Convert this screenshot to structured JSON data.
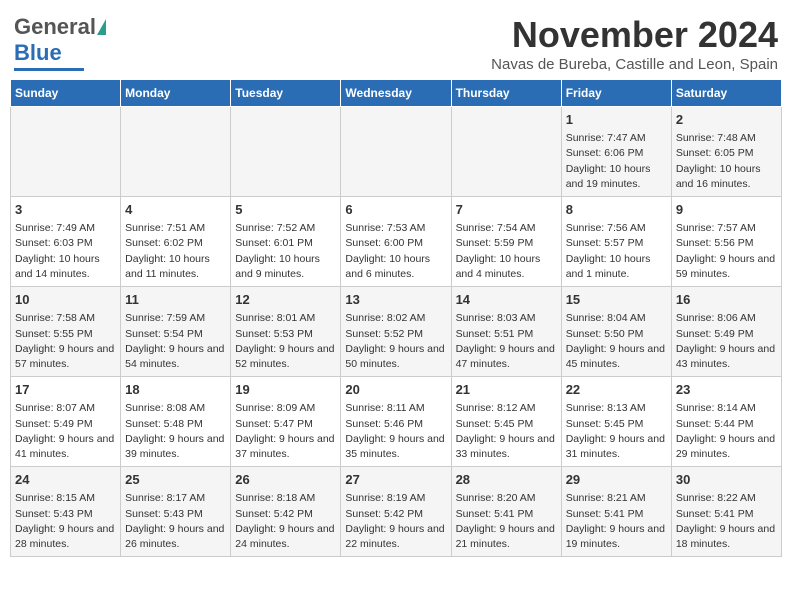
{
  "header": {
    "logo_general": "General",
    "logo_blue": "Blue",
    "month_title": "November 2024",
    "location": "Navas de Bureba, Castille and Leon, Spain"
  },
  "days_of_week": [
    "Sunday",
    "Monday",
    "Tuesday",
    "Wednesday",
    "Thursday",
    "Friday",
    "Saturday"
  ],
  "weeks": [
    [
      {
        "day": "",
        "info": ""
      },
      {
        "day": "",
        "info": ""
      },
      {
        "day": "",
        "info": ""
      },
      {
        "day": "",
        "info": ""
      },
      {
        "day": "",
        "info": ""
      },
      {
        "day": "1",
        "info": "Sunrise: 7:47 AM\nSunset: 6:06 PM\nDaylight: 10 hours and 19 minutes."
      },
      {
        "day": "2",
        "info": "Sunrise: 7:48 AM\nSunset: 6:05 PM\nDaylight: 10 hours and 16 minutes."
      }
    ],
    [
      {
        "day": "3",
        "info": "Sunrise: 7:49 AM\nSunset: 6:03 PM\nDaylight: 10 hours and 14 minutes."
      },
      {
        "day": "4",
        "info": "Sunrise: 7:51 AM\nSunset: 6:02 PM\nDaylight: 10 hours and 11 minutes."
      },
      {
        "day": "5",
        "info": "Sunrise: 7:52 AM\nSunset: 6:01 PM\nDaylight: 10 hours and 9 minutes."
      },
      {
        "day": "6",
        "info": "Sunrise: 7:53 AM\nSunset: 6:00 PM\nDaylight: 10 hours and 6 minutes."
      },
      {
        "day": "7",
        "info": "Sunrise: 7:54 AM\nSunset: 5:59 PM\nDaylight: 10 hours and 4 minutes."
      },
      {
        "day": "8",
        "info": "Sunrise: 7:56 AM\nSunset: 5:57 PM\nDaylight: 10 hours and 1 minute."
      },
      {
        "day": "9",
        "info": "Sunrise: 7:57 AM\nSunset: 5:56 PM\nDaylight: 9 hours and 59 minutes."
      }
    ],
    [
      {
        "day": "10",
        "info": "Sunrise: 7:58 AM\nSunset: 5:55 PM\nDaylight: 9 hours and 57 minutes."
      },
      {
        "day": "11",
        "info": "Sunrise: 7:59 AM\nSunset: 5:54 PM\nDaylight: 9 hours and 54 minutes."
      },
      {
        "day": "12",
        "info": "Sunrise: 8:01 AM\nSunset: 5:53 PM\nDaylight: 9 hours and 52 minutes."
      },
      {
        "day": "13",
        "info": "Sunrise: 8:02 AM\nSunset: 5:52 PM\nDaylight: 9 hours and 50 minutes."
      },
      {
        "day": "14",
        "info": "Sunrise: 8:03 AM\nSunset: 5:51 PM\nDaylight: 9 hours and 47 minutes."
      },
      {
        "day": "15",
        "info": "Sunrise: 8:04 AM\nSunset: 5:50 PM\nDaylight: 9 hours and 45 minutes."
      },
      {
        "day": "16",
        "info": "Sunrise: 8:06 AM\nSunset: 5:49 PM\nDaylight: 9 hours and 43 minutes."
      }
    ],
    [
      {
        "day": "17",
        "info": "Sunrise: 8:07 AM\nSunset: 5:49 PM\nDaylight: 9 hours and 41 minutes."
      },
      {
        "day": "18",
        "info": "Sunrise: 8:08 AM\nSunset: 5:48 PM\nDaylight: 9 hours and 39 minutes."
      },
      {
        "day": "19",
        "info": "Sunrise: 8:09 AM\nSunset: 5:47 PM\nDaylight: 9 hours and 37 minutes."
      },
      {
        "day": "20",
        "info": "Sunrise: 8:11 AM\nSunset: 5:46 PM\nDaylight: 9 hours and 35 minutes."
      },
      {
        "day": "21",
        "info": "Sunrise: 8:12 AM\nSunset: 5:45 PM\nDaylight: 9 hours and 33 minutes."
      },
      {
        "day": "22",
        "info": "Sunrise: 8:13 AM\nSunset: 5:45 PM\nDaylight: 9 hours and 31 minutes."
      },
      {
        "day": "23",
        "info": "Sunrise: 8:14 AM\nSunset: 5:44 PM\nDaylight: 9 hours and 29 minutes."
      }
    ],
    [
      {
        "day": "24",
        "info": "Sunrise: 8:15 AM\nSunset: 5:43 PM\nDaylight: 9 hours and 28 minutes."
      },
      {
        "day": "25",
        "info": "Sunrise: 8:17 AM\nSunset: 5:43 PM\nDaylight: 9 hours and 26 minutes."
      },
      {
        "day": "26",
        "info": "Sunrise: 8:18 AM\nSunset: 5:42 PM\nDaylight: 9 hours and 24 minutes."
      },
      {
        "day": "27",
        "info": "Sunrise: 8:19 AM\nSunset: 5:42 PM\nDaylight: 9 hours and 22 minutes."
      },
      {
        "day": "28",
        "info": "Sunrise: 8:20 AM\nSunset: 5:41 PM\nDaylight: 9 hours and 21 minutes."
      },
      {
        "day": "29",
        "info": "Sunrise: 8:21 AM\nSunset: 5:41 PM\nDaylight: 9 hours and 19 minutes."
      },
      {
        "day": "30",
        "info": "Sunrise: 8:22 AM\nSunset: 5:41 PM\nDaylight: 9 hours and 18 minutes."
      }
    ]
  ]
}
